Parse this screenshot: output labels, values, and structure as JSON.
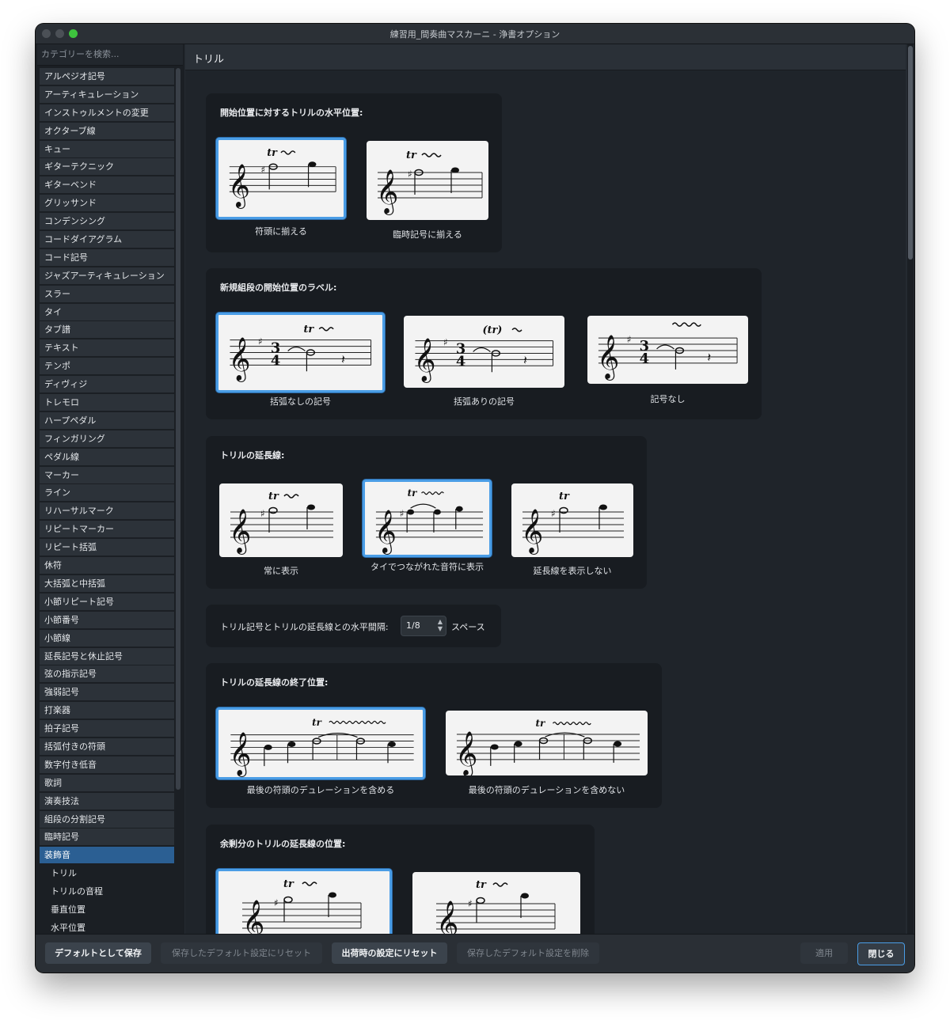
{
  "window": {
    "title": "練習用_間奏曲マスカーニ - 浄書オプション"
  },
  "sidebar": {
    "search_placeholder": "カテゴリーを検索...",
    "categories": [
      "アルペジオ記号",
      "アーティキュレーション",
      "インストゥルメントの変更",
      "オクターブ線",
      "キュー",
      "ギターテクニック",
      "ギターベンド",
      "グリッサンド",
      "コンデンシング",
      "コードダイアグラム",
      "コード記号",
      "ジャズアーティキュレーション",
      "スラー",
      "タイ",
      "タブ譜",
      "テキスト",
      "テンポ",
      "ディヴィジ",
      "トレモロ",
      "ハープペダル",
      "フィンガリング",
      "ペダル線",
      "マーカー",
      "ライン",
      "リハーサルマーク",
      "リピートマーカー",
      "リピート括弧",
      "休符",
      "大括弧と中括弧",
      "小節リピート記号",
      "小節番号",
      "小節線",
      "延長記号と休止記号",
      "弦の指示記号",
      "強弱記号",
      "打楽器",
      "拍子記号",
      "括弧付きの符頭",
      "数字付き低音",
      "歌詞",
      "演奏技法",
      "組段の分割記号",
      "臨時記号"
    ],
    "active_category": "装飾音",
    "subitems": [
      "トリル",
      "トリルの音程",
      "垂直位置",
      "水平位置"
    ]
  },
  "main": {
    "header": "トリル",
    "groups": {
      "g1": {
        "title": "開始位置に対するトリルの水平位置:",
        "options": [
          "符頭に揃える",
          "臨時記号に揃える"
        ],
        "selected": 0
      },
      "g2": {
        "title": "新規組段の開始位置のラベル:",
        "options": [
          "括弧なしの記号",
          "括弧ありの記号",
          "記号なし"
        ],
        "selected": 0
      },
      "g3": {
        "title": "トリルの延長線:",
        "options": [
          "常に表示",
          "タイでつながれた音符に表示",
          "延長線を表示しない"
        ],
        "selected": 1
      },
      "g4": {
        "label": "トリル記号とトリルの延長線との水平間隔:",
        "value": "1/8",
        "unit": "スペース"
      },
      "g5": {
        "title": "トリルの延長線の終了位置:",
        "options": [
          "最後の符頭のデュレーションを含める",
          "最後の符頭のデュレーションを含めない"
        ],
        "selected": 0
      },
      "g6": {
        "title": "余剰分のトリルの延長線の位置:",
        "selected": 0
      }
    },
    "notation": {
      "trill": "tr",
      "trill_paren": "(tr)",
      "time_top": "3",
      "time_bottom": "4"
    }
  },
  "footer": {
    "save_default": "デフォルトとして保存",
    "reset_saved": "保存したデフォルト設定にリセット",
    "reset_factory": "出荷時の設定にリセット",
    "delete_saved": "保存したデフォルト設定を削除",
    "apply": "適用",
    "close": "閉じる"
  },
  "colors": {
    "accent": "#4a9de6",
    "selection": "#2b5f93"
  }
}
